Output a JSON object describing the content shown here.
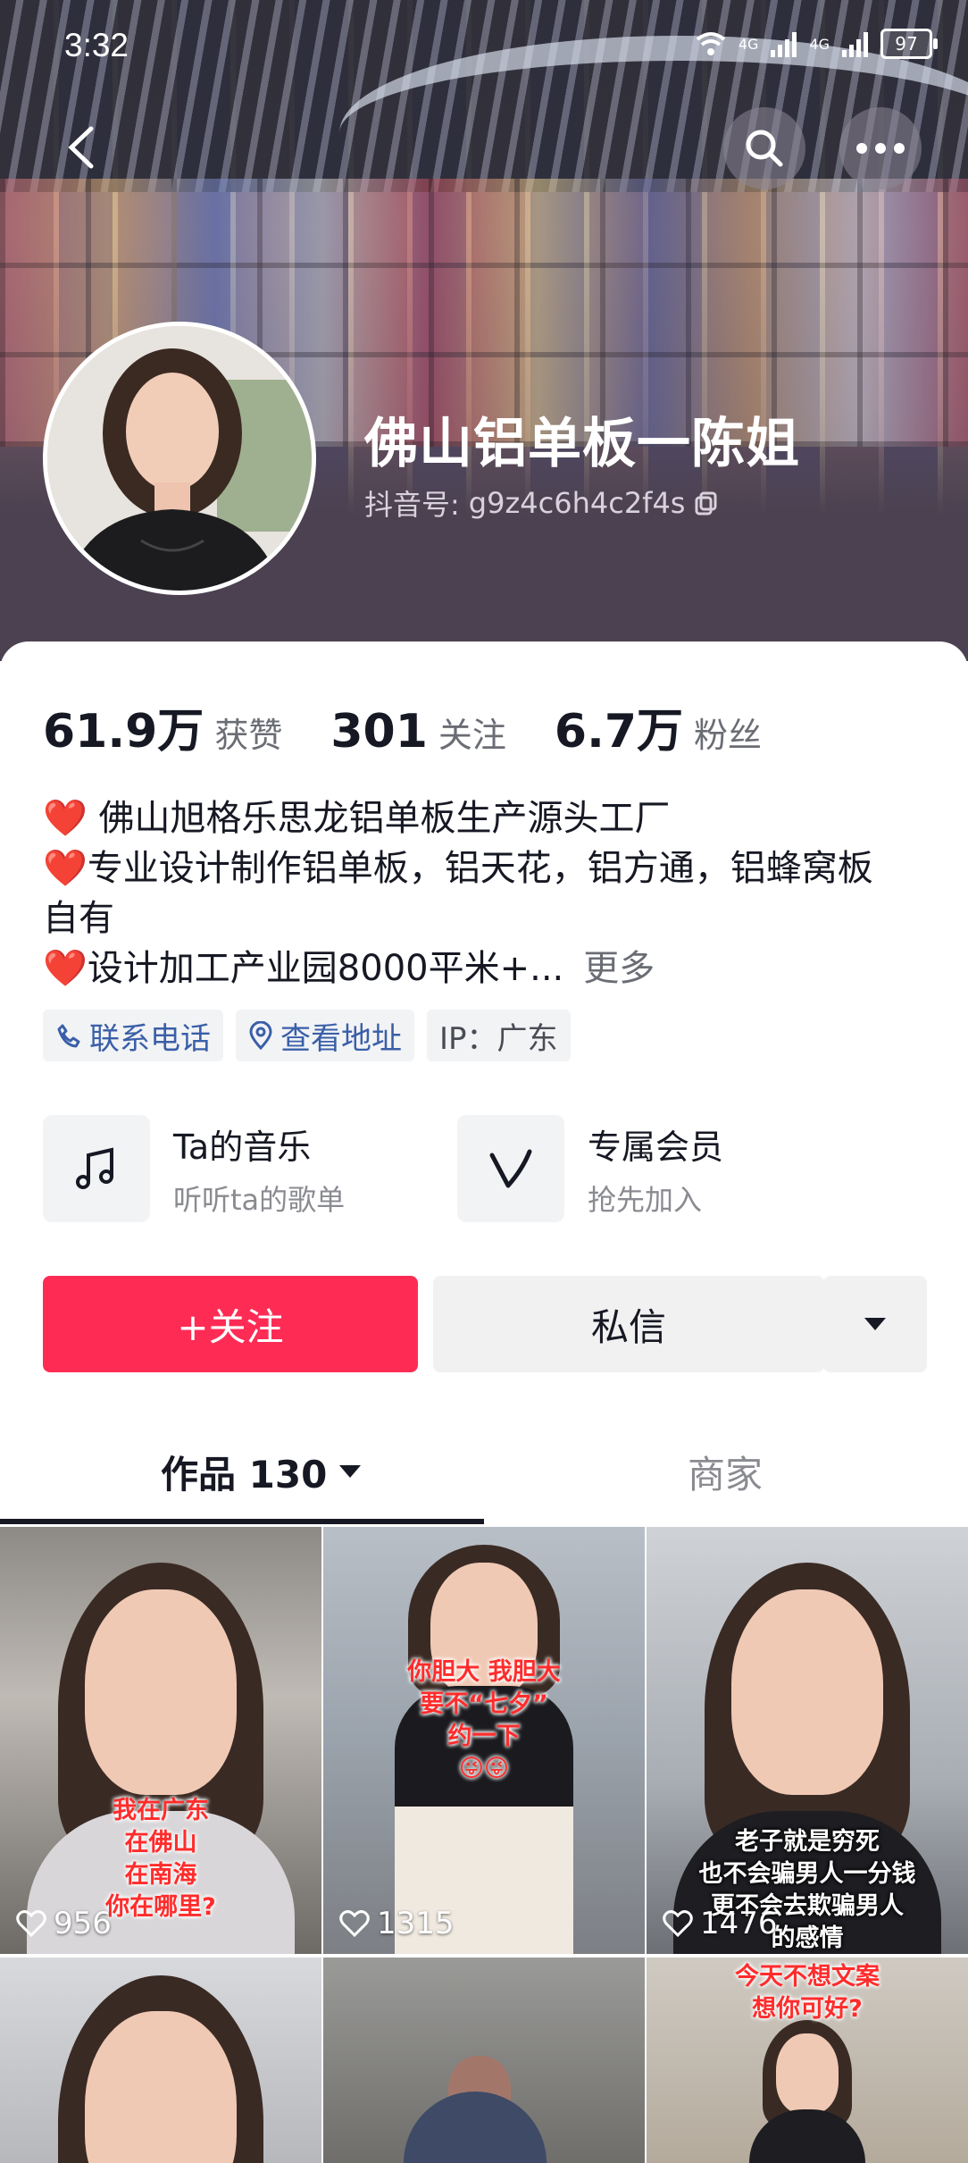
{
  "status_bar": {
    "time": "3:32",
    "network_1": "4G",
    "network_2": "4G",
    "battery": "97"
  },
  "header": {
    "nickname": "佛山铝单板一陈姐",
    "douyin_id_label": "抖音号:",
    "douyin_id": "g9z4c6h4c2f4s"
  },
  "stats": [
    {
      "value": "61.9万",
      "label": "获赞"
    },
    {
      "value": "301",
      "label": "关注"
    },
    {
      "value": "6.7万",
      "label": "粉丝"
    }
  ],
  "bio": {
    "heart": "❤️",
    "line1": " 佛山旭格乐思龙铝单板生产源头工厂",
    "line2": "专业设计制作铝单板，铝天花，铝方通，铝蜂窝板",
    "line3": "自有",
    "line4": "设计加工产业园8000平米+...",
    "more": "更多"
  },
  "tags": {
    "phone": "联系电话",
    "address": "查看地址",
    "ip": "IP：广东"
  },
  "features": [
    {
      "title": "Ta的音乐",
      "subtitle": "听听ta的歌单",
      "icon": "music-note-icon"
    },
    {
      "title": "专属会员",
      "subtitle": "抢先加入",
      "icon": "vip-v-icon"
    }
  ],
  "actions": {
    "follow": "+关注",
    "message": "私信"
  },
  "tabs": {
    "works": "作品 130",
    "merchant": "商家"
  },
  "grid": [
    {
      "likes": "956",
      "caption": [
        "我在广东",
        "在佛山",
        "在南海",
        "你在哪里?"
      ],
      "caption_color": "red"
    },
    {
      "likes": "1315",
      "caption": [
        "你胆大  我胆大",
        "要不“七夕”",
        "约一下",
        "😜😜"
      ],
      "caption_color": "red"
    },
    {
      "likes": "1476",
      "caption": [
        "老子就是穷死",
        "也不会骗男人一分钱",
        "更不会去欺骗男人",
        "的感情"
      ],
      "caption_color": "white"
    },
    {
      "likes": "",
      "caption": [],
      "caption_color": "red"
    },
    {
      "likes": "",
      "caption": [],
      "caption_color": "red"
    },
    {
      "likes": "",
      "caption": [
        "今天不想文案",
        "想你可好?"
      ],
      "caption_color": "red"
    }
  ],
  "colors": {
    "accent": "#fe2c55",
    "link": "#3a5fa8",
    "heart": "#e8233a"
  }
}
